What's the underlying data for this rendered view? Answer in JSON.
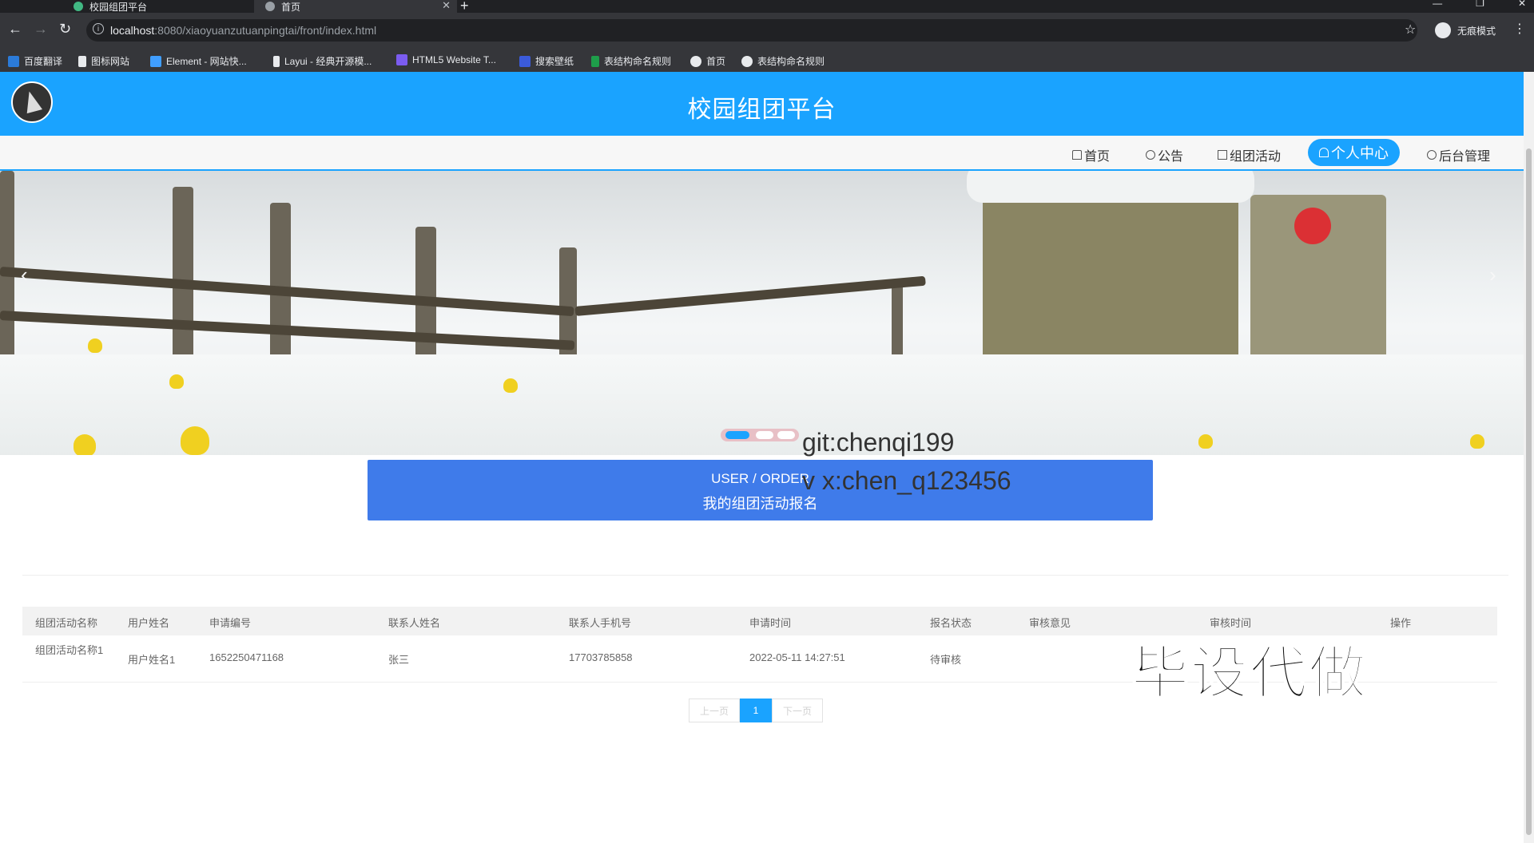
{
  "browser": {
    "tabs": [
      {
        "title": "校园组团平台",
        "active": false
      },
      {
        "title": "首页",
        "active": true
      }
    ],
    "url_host": "localhost",
    "url_path": ":8080/xiaoyuanzutuanpingtai/front/index.html",
    "profile_label": "无痕模式",
    "bookmarks": [
      "百度翻译",
      "图标网站",
      "Element - 网站快...",
      "Layui - 经典开源模...",
      "HTML5 Website T...",
      "搜索壁纸",
      "表结构命名规则",
      "首页",
      "表结构命名规则"
    ]
  },
  "header": {
    "title": "校园组团平台"
  },
  "nav": {
    "items": [
      {
        "label": "首页",
        "icon": "home-icon"
      },
      {
        "label": "公告",
        "icon": "notice-icon"
      },
      {
        "label": "组团活动",
        "icon": "grid-icon"
      },
      {
        "label": "个人中心",
        "icon": "user-icon",
        "active": true
      },
      {
        "label": "后台管理",
        "icon": "link-icon"
      }
    ]
  },
  "carousel": {
    "prev": "‹",
    "next": "›",
    "active_index": 0,
    "count": 3
  },
  "section": {
    "en": "USER / ORDER",
    "cn": "我的组团活动报名"
  },
  "table": {
    "columns": [
      "组团活动名称",
      "用户姓名",
      "申请编号",
      "联系人姓名",
      "联系人手机号",
      "申请时间",
      "报名状态",
      "审核意见",
      "审核时间",
      "操作"
    ],
    "rows": [
      [
        "组团活动名称1",
        "用户姓名1",
        "1652250471168",
        "张三",
        "17703785858",
        "2022-05-11 14:27:51",
        "待审核",
        "",
        "",
        ""
      ]
    ]
  },
  "pagination": {
    "prev": "上一页",
    "current": "1",
    "next": "下一页"
  },
  "watermarks": {
    "git": "git:chenqi199",
    "wx": "v x:chen_q123456",
    "ad": "毕设代做"
  },
  "colors": {
    "brand": "#1aa3ff",
    "section_bar": "#3f7bea"
  }
}
